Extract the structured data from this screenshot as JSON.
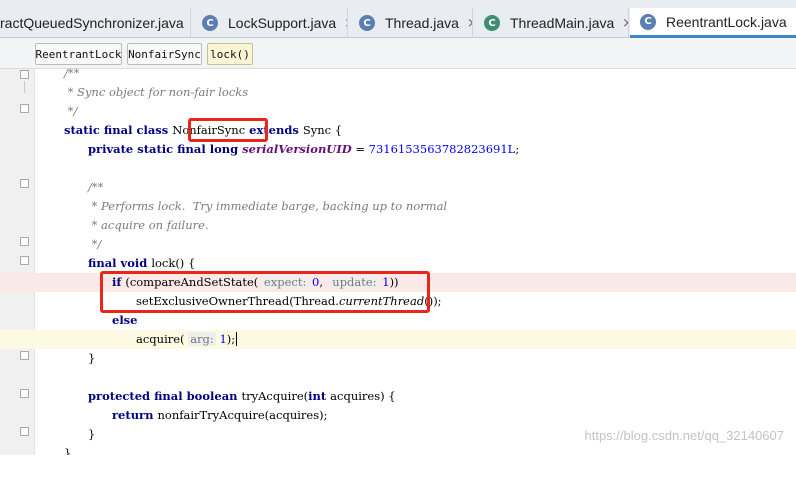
{
  "tabs": [
    {
      "label": "ractQueuedSynchronizer.java",
      "icon": "none",
      "close": "×"
    },
    {
      "label": "LockSupport.java",
      "icon": "class-icon",
      "close": "×"
    },
    {
      "label": "Thread.java",
      "icon": "class-icon",
      "close": "×"
    },
    {
      "label": "ThreadMain.java",
      "icon": "runnable-class-icon",
      "close": "×"
    },
    {
      "label": "ReentrantLock.java",
      "icon": "class-icon",
      "close": "×",
      "active": true
    }
  ],
  "breadcrumb": [
    "ReentrantLock",
    "NonfairSync",
    "lock()"
  ],
  "code": {
    "l1": "/**",
    "l2": " * Sync object for non-fair locks",
    "l3": " */",
    "l4_kw": "static final class ",
    "l4_name": "NonfairSync",
    "l4_kw2": " extends ",
    "l4_rest": "Sync {",
    "l5_kw": "private static final long ",
    "l5_field": "serialVersionUID",
    "l5_eq": " = ",
    "l5_num": "7316153563782823691L",
    "l5_end": ";",
    "l7": "/**",
    "l8": " * Performs lock.  Try immediate barge, backing up to normal",
    "l9": " * acquire on failure.",
    "l10": " */",
    "l11_kw": "final void ",
    "l11_rest": "lock() {",
    "l12_kw": "if ",
    "l12_a": "(compareAndSetState(",
    "l12_hint1": "expect:",
    "l12_num1": "0",
    "l12_sep": ",  ",
    "l12_hint2": "update:",
    "l12_num2": "1",
    "l12_end": "))",
    "l13_a": "setExclusiveOwnerThread(Thread.",
    "l13_ital": "currentThread",
    "l13_end": "());",
    "l14_kw": "else",
    "l15_a": "acquire(",
    "l15_hint": "arg:",
    "l15_num": "1",
    "l15_end": ");",
    "l16": "}",
    "l18_kw": "protected final boolean ",
    "l18_a": "tryAcquire(",
    "l18_kw2": "int ",
    "l18_end": "acquires) {",
    "l19_kw": "return ",
    "l19_rest": "nonfairTryAcquire(acquires);",
    "l20": "}",
    "l21": "}"
  },
  "watermark": "https://blog.csdn.net/qq_32140607",
  "colors": {
    "highlight_box": "#e8261c",
    "keyword": "#000080",
    "number": "#0000ff",
    "comment": "#7a7a7a",
    "field": "#660e7a"
  }
}
